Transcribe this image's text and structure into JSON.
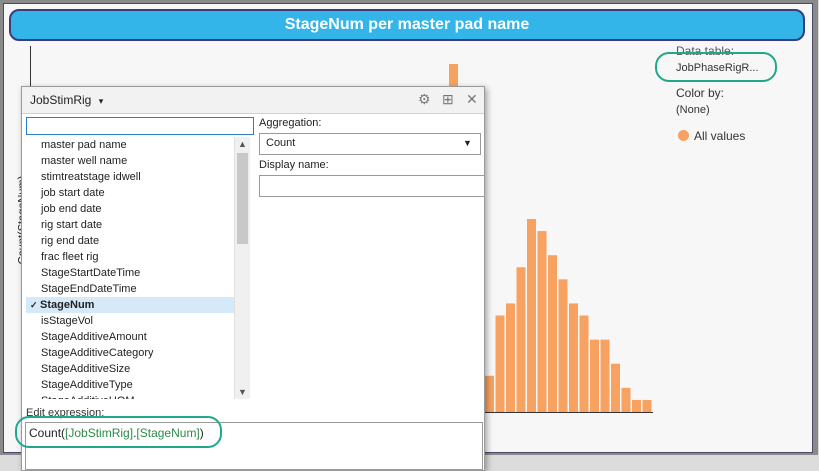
{
  "chart": {
    "title": "StageNum per master pad name",
    "ylabel": "Count(StageNum)"
  },
  "chart_data": {
    "type": "bar",
    "title": "StageNum per master pad name",
    "xlabel": "",
    "ylabel": "Count(StageNum)",
    "values": [
      3,
      8,
      9,
      12,
      16,
      15,
      13,
      11,
      9,
      8,
      6,
      6,
      4,
      2,
      1,
      1
    ]
  },
  "legend": {
    "data_table_label": "Data table:",
    "data_table_value": "JobPhaseRigR...",
    "color_by_label": "Color by:",
    "color_by_value": "(None)",
    "series_label": "All values"
  },
  "dialog": {
    "title": "JobStimRig",
    "title_caret": "▾",
    "icons": {
      "settings": "⚙",
      "popout": "⊞",
      "close": "✕"
    },
    "search_value": "",
    "columns": [
      "master pad name",
      "master well name",
      "stimtreatstage idwell",
      "job start date",
      "job end date",
      "rig start date",
      "rig end date",
      "frac fleet rig",
      "StageStartDateTime",
      "StageEndDateTime",
      "StageNum",
      "isStageVol",
      "StageAdditiveAmount",
      "StageAdditiveCategory",
      "StageAdditiveSize",
      "StageAdditiveType",
      "StageAdditiveUOM"
    ],
    "selected_index": 10,
    "check_mark": "✓",
    "aggregation_label": "Aggregation:",
    "aggregation_value": "Count",
    "display_name_label": "Display name:",
    "display_name_value": "",
    "edit_expression_label": "Edit expression:",
    "expression": {
      "func_open": "Count(",
      "table": "[JobStimRig]",
      "dot": ".",
      "column": "[StageNum]",
      "close": ")"
    }
  },
  "colors": {
    "accent": "#33b5ea",
    "bar": "#f7a260",
    "highlight": "#21a88b"
  }
}
